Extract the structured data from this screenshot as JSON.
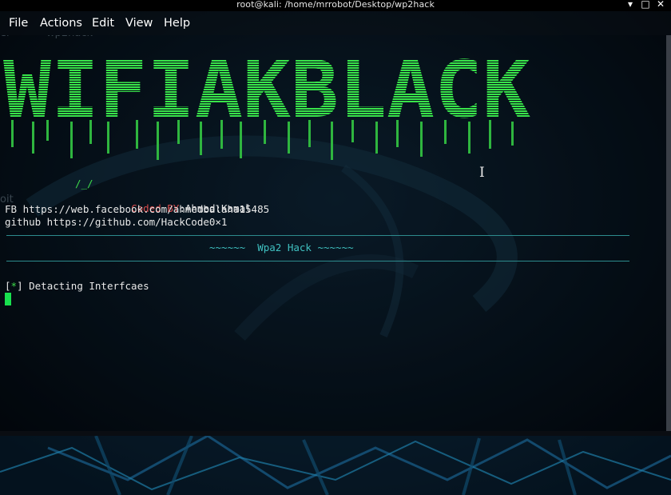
{
  "window": {
    "title": "root@kali: /home/mrrobot/Desktop/wp2hack",
    "minimize_glyph": "▾",
    "maximize_glyph": "□",
    "close_glyph": "✕"
  },
  "menubar": {
    "items": [
      "File",
      "Actions",
      "Edit",
      "View",
      "Help"
    ]
  },
  "background_text": {
    "desktop_label_1": "er",
    "desktop_label_2": "wp2hack",
    "desktop_label_3": "oit"
  },
  "terminal": {
    "banner_text": "WIFIAKBLACK",
    "slash_line": "/_/",
    "coded_by_label": "Coded BY",
    "coded_by_name": ":Ahmed:Kamal",
    "fb_line": "FB https://web.facebook.com/ahmedbalaha15485",
    "github_line": "github https://github.com/HackCode0×1",
    "section_title": "~~~~~~  Wpa2 Hack ~~~~~~",
    "status_bracket_open": "[",
    "status_star": "*",
    "status_bracket_close": "]",
    "status_text": " Detacting Interfcaes"
  },
  "colors": {
    "accent_green": "#3ddc4a",
    "coded_by_red": "#d94c4c",
    "cyan_text": "#3fc0c0",
    "white_text": "#e8e8e8",
    "rule_teal": "#2d8b8d"
  }
}
